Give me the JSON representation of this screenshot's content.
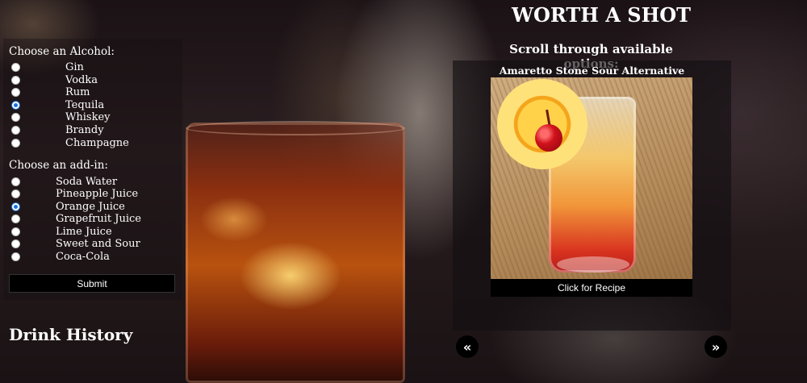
{
  "app": {
    "title": "WORTH A SHOT",
    "subtitle": "Scroll through available options:"
  },
  "alcohol": {
    "label": "Choose an Alcohol:",
    "options": [
      "Gin",
      "Vodka",
      "Rum",
      "Tequila",
      "Whiskey",
      "Brandy",
      "Champagne"
    ],
    "selected": "Tequila"
  },
  "addin": {
    "label": "Choose an add-in:",
    "options": [
      "Soda Water",
      "Pineapple Juice",
      "Orange Juice",
      "Grapefruit Juice",
      "Lime Juice",
      "Sweet and Sour",
      "Coca-Cola"
    ],
    "selected": "Orange Juice"
  },
  "form": {
    "submit_label": "Submit"
  },
  "history": {
    "title": "Drink History"
  },
  "carousel": {
    "drink_name": "Amaretto Stone Sour Alternative",
    "recipe_label": "Click for Recipe",
    "prev_icon": "«",
    "next_icon": "»"
  },
  "colors": {
    "radio_checked": "#1a6fe0",
    "button_bg": "#000000"
  }
}
